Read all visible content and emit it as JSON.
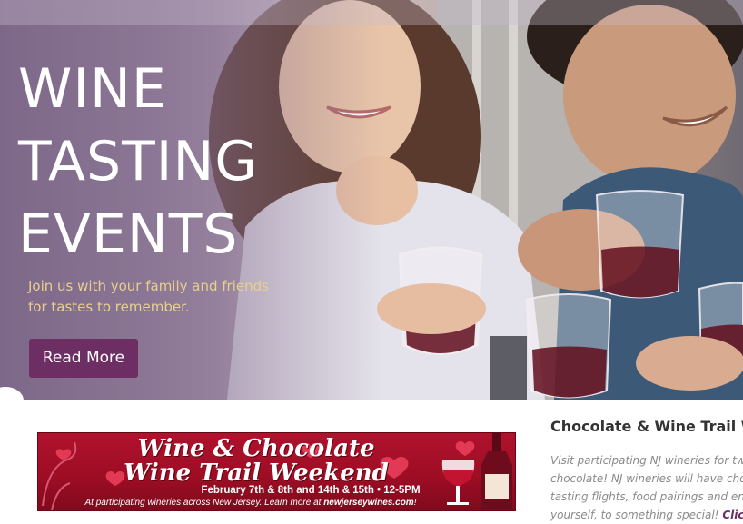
{
  "hero": {
    "title_lines": [
      "WINE",
      "TASTING",
      "EVENTS"
    ],
    "subtitle_lines": [
      "Join us with your family and friends",
      "for tastes to remember."
    ],
    "cta_label": "Read More",
    "photo_icon": "couple-toasting-wine-photo"
  },
  "banner": {
    "title_line1": "Wine & Chocolate",
    "title_line2": "Wine Trail Weekend",
    "dates": "February 7th & 8th and 14th & 15th • 12-5PM",
    "footer_prefix": "At participating wineries across New Jersey.  Learn more at ",
    "footer_link": "newjerseywines.com",
    "footer_suffix": "!",
    "art_icons": [
      "heart-icon",
      "wine-glass-icon",
      "wine-bottle-icon"
    ]
  },
  "article": {
    "title": "Chocolate & Wine Trail We",
    "body_lines": [
      "Visit participating NJ wineries for two",
      "chocolate! NJ wineries will have choco",
      "tasting flights, food pairings and ente",
      "yourself, to something special!"
    ],
    "link_text": "Click h"
  },
  "colors": {
    "accent_purple": "#6d2e64",
    "subtitle_gold": "#e8cf8f",
    "banner_red": "#a50f27"
  }
}
